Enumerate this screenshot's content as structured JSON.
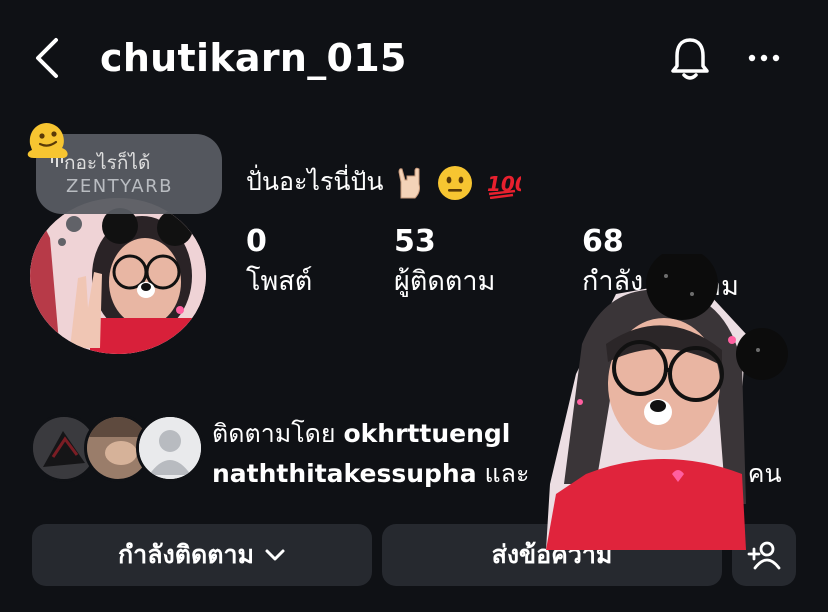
{
  "header": {
    "username": "chutikarn_015",
    "back_icon": "chevron-left-icon",
    "notification_icon": "bell-icon",
    "more_icon": "more-horizontal-icon"
  },
  "note": {
    "line1": "กอะไรก็ได้",
    "line2": "ZENTYARB"
  },
  "profile": {
    "display_name": "ปั่นอะไรนี่ปัน",
    "stats": [
      {
        "value": "0",
        "label": "โพสต์"
      },
      {
        "value": "53",
        "label": "ผู้ติดตาม"
      },
      {
        "value": "68",
        "label": "กำลัง"
      },
      {
        "value": "",
        "label": "าม"
      }
    ]
  },
  "followed_by": {
    "prefix": "ติดตามโดย",
    "user1": "okhrttuengl",
    "user2": "naththitakessupha",
    "conjunction": "และ",
    "count_tail": "29 คน"
  },
  "actions": {
    "following_label": "กำลังติดตาม",
    "message_label": "ส่งข้อความ",
    "add_user_icon": "add-person-icon"
  },
  "colors": {
    "background": "#0f1115",
    "button": "#26292f",
    "note_bubble": "#585c62"
  }
}
